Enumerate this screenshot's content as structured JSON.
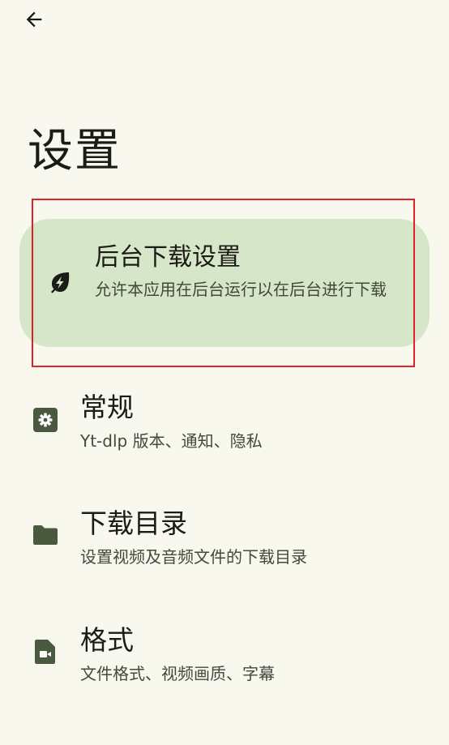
{
  "header": {
    "back_icon": "arrow-left-icon",
    "title": "设置"
  },
  "colors": {
    "background": "#f8f8ee",
    "highlight_card": "#d6e6c8",
    "icon": "#4a5a3e",
    "focus_outline": "#e0202a"
  },
  "highlight": {
    "icon": "eco-leaf-bolt-icon",
    "title": "后台下载设置",
    "subtitle": "允许本应用在后台运行以在后台进行下载"
  },
  "items": [
    {
      "icon": "settings-gear-icon",
      "title": "常规",
      "subtitle": "Yt-dlp 版本、通知、隐私"
    },
    {
      "icon": "folder-icon",
      "title": "下载目录",
      "subtitle": "设置视频及音频文件的下载目录"
    },
    {
      "icon": "video-file-icon",
      "title": "格式",
      "subtitle": "文件格式、视频画质、字幕"
    }
  ]
}
